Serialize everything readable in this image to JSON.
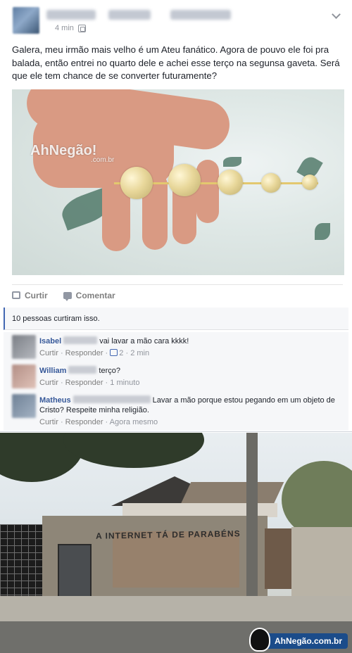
{
  "post": {
    "time": "4 min",
    "text": "Galera, meu irmão mais velho é um Ateu fanático. Agora de pouvo ele foi pra balada, então entrei no quarto dele e achei esse terço na segunsa gaveta. Será que ele tem chance de se converter futuramente?",
    "watermark": "AhNegão!",
    "watermark_sub": ".com.br",
    "actions": {
      "like": "Curtir",
      "comment": "Comentar"
    },
    "likes_summary": "10 pessoas curtiram isso."
  },
  "comments": [
    {
      "name": "Isabel",
      "text": "vai lavar a mão cara kkkk!",
      "reply": "Responder",
      "like": "Curtir",
      "like_count": "2",
      "time": "2 min"
    },
    {
      "name": "William",
      "text": "terço?",
      "reply": "Responder",
      "like": "Curtir",
      "time": "1 minuto"
    },
    {
      "name": "Matheus",
      "text": "Lavar a mão porque estou pegando em um objeto de Cristo? Respeite minha religião.",
      "reply": "Responder",
      "like": "Curtir",
      "time": "Agora mesmo"
    }
  ],
  "street": {
    "graffiti": "A INTERNET TÁ DE PARABÉNS",
    "brand": "AhNegão.com.br"
  },
  "colors": {
    "link": "#365899",
    "meta": "#90949c",
    "accent": "#4267b2"
  }
}
